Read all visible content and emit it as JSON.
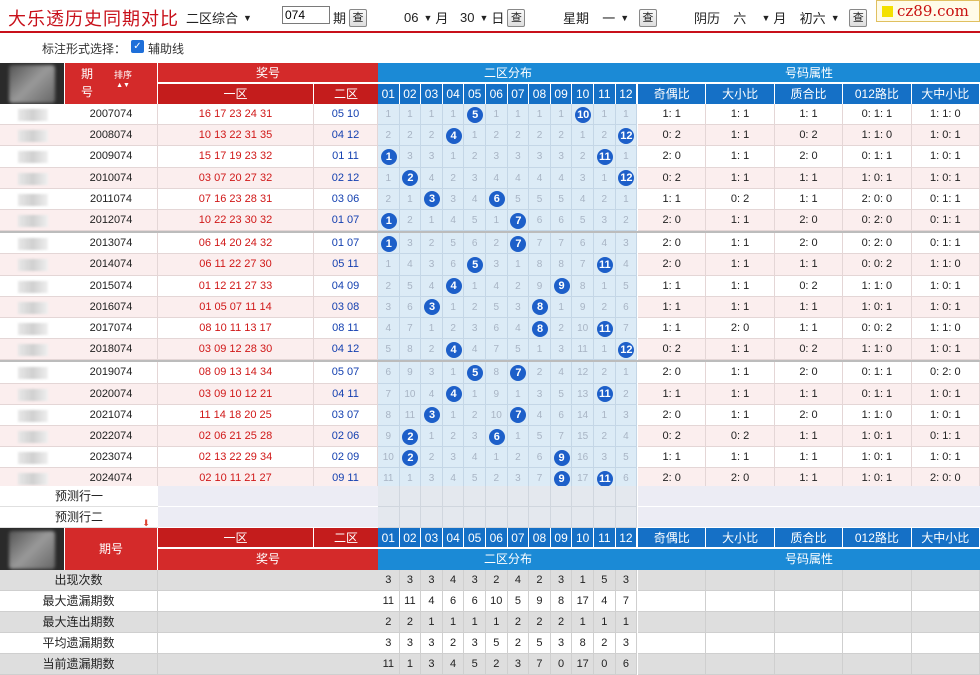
{
  "header": {
    "title": "大乐透历史同期对比",
    "zone_select": "二区综合",
    "period_value": "074",
    "period_label": "期",
    "month_value": "06",
    "month_label": "月",
    "day_value": "30",
    "day_label": "日",
    "weekday_label": "星期",
    "weekday_value": "一",
    "lunar_label": "阴历",
    "lunar_month": "六",
    "lunar_month_label": "月",
    "lunar_day": "初六",
    "query_label": "查",
    "logo": "cz89.com"
  },
  "markbar": {
    "label": "标注形式选择：",
    "checkbox_label": "辅助线",
    "checkbox_mark": "✓"
  },
  "columns": {
    "period": "期号",
    "period_top": "期",
    "period_bottom": "号",
    "sort": "排序",
    "prize": "奖号",
    "zone1": "一区",
    "zone2": "二区",
    "dist": "二区分布",
    "attr": "号码属性",
    "numbers": [
      "01",
      "02",
      "03",
      "04",
      "05",
      "06",
      "07",
      "08",
      "09",
      "10",
      "11",
      "12"
    ],
    "attrs": [
      "奇偶比",
      "大小比",
      "质合比",
      "012路比",
      "大中小比"
    ]
  },
  "rows": [
    {
      "period": "2007074",
      "front": "16 17 23 24 31",
      "back": "05 10",
      "dist": [
        1,
        1,
        1,
        1,
        "05",
        1,
        1,
        1,
        1,
        "10",
        1,
        1
      ],
      "attrs": [
        "1: 1",
        "1: 1",
        "1: 1",
        "0: 1: 1",
        "1: 1: 0"
      ]
    },
    {
      "period": "2008074",
      "front": "10 13 22 31 35",
      "back": "04 12",
      "dist": [
        2,
        2,
        2,
        "04",
        1,
        2,
        2,
        2,
        2,
        1,
        2,
        "12"
      ],
      "attrs": [
        "0: 2",
        "1: 1",
        "0: 2",
        "1: 1: 0",
        "1: 0: 1"
      ]
    },
    {
      "period": "2009074",
      "front": "15 17 19 23 32",
      "back": "01 11",
      "dist": [
        "01",
        3,
        3,
        1,
        2,
        3,
        3,
        3,
        3,
        2,
        "11",
        1
      ],
      "attrs": [
        "2: 0",
        "1: 1",
        "2: 0",
        "0: 1: 1",
        "1: 0: 1"
      ]
    },
    {
      "period": "2010074",
      "front": "03 07 20 27 32",
      "back": "02 12",
      "dist": [
        1,
        "02",
        4,
        2,
        3,
        4,
        4,
        4,
        4,
        3,
        1,
        "12"
      ],
      "attrs": [
        "0: 2",
        "1: 1",
        "1: 1",
        "1: 0: 1",
        "1: 0: 1"
      ]
    },
    {
      "period": "2011074",
      "front": "07 16 23 28 31",
      "back": "03 06",
      "dist": [
        2,
        1,
        "03",
        3,
        4,
        "06",
        5,
        5,
        5,
        4,
        2,
        1
      ],
      "attrs": [
        "1: 1",
        "0: 2",
        "1: 1",
        "2: 0: 0",
        "0: 1: 1"
      ]
    },
    {
      "period": "2012074",
      "front": "10 22 23 30 32",
      "back": "01 07",
      "dist": [
        "01",
        2,
        1,
        4,
        5,
        1,
        "07",
        6,
        6,
        5,
        3,
        2
      ],
      "attrs": [
        "2: 0",
        "1: 1",
        "2: 0",
        "0: 2: 0",
        "0: 1: 1"
      ]
    },
    {
      "period": "2013074",
      "front": "06 14 20 24 32",
      "back": "01 07",
      "dist": [
        "01",
        3,
        2,
        5,
        6,
        2,
        "07",
        7,
        7,
        6,
        4,
        3
      ],
      "attrs": [
        "2: 0",
        "1: 1",
        "2: 0",
        "0: 2: 0",
        "0: 1: 1"
      ]
    },
    {
      "period": "2014074",
      "front": "06 11 22 27 30",
      "back": "05 11",
      "dist": [
        1,
        4,
        3,
        6,
        "05",
        3,
        1,
        8,
        8,
        7,
        "11",
        4
      ],
      "attrs": [
        "2: 0",
        "1: 1",
        "1: 1",
        "0: 0: 2",
        "1: 1: 0"
      ]
    },
    {
      "period": "2015074",
      "front": "01 12 21 27 33",
      "back": "04 09",
      "dist": [
        2,
        5,
        4,
        "04",
        1,
        4,
        2,
        9,
        "09",
        8,
        1,
        5
      ],
      "attrs": [
        "1: 1",
        "1: 1",
        "0: 2",
        "1: 1: 0",
        "1: 0: 1"
      ]
    },
    {
      "period": "2016074",
      "front": "01 05 07 11 14",
      "back": "03 08",
      "dist": [
        3,
        6,
        "03",
        1,
        2,
        5,
        3,
        "08",
        1,
        9,
        2,
        6
      ],
      "attrs": [
        "1: 1",
        "1: 1",
        "1: 1",
        "1: 0: 1",
        "1: 0: 1"
      ]
    },
    {
      "period": "2017074",
      "front": "08 10 11 13 17",
      "back": "08 11",
      "dist": [
        4,
        7,
        1,
        2,
        3,
        6,
        4,
        "08",
        2,
        10,
        "11",
        7
      ],
      "attrs": [
        "1: 1",
        "2: 0",
        "1: 1",
        "0: 0: 2",
        "1: 1: 0"
      ]
    },
    {
      "period": "2018074",
      "front": "03 09 12 28 30",
      "back": "04 12",
      "dist": [
        5,
        8,
        2,
        "04",
        4,
        7,
        5,
        1,
        3,
        11,
        1,
        "12"
      ],
      "attrs": [
        "0: 2",
        "1: 1",
        "0: 2",
        "1: 1: 0",
        "1: 0: 1"
      ]
    },
    {
      "period": "2019074",
      "front": "08 09 13 14 34",
      "back": "05 07",
      "dist": [
        6,
        9,
        3,
        1,
        "05",
        8,
        "07",
        2,
        4,
        12,
        2,
        1
      ],
      "attrs": [
        "2: 0",
        "1: 1",
        "2: 0",
        "0: 1: 1",
        "0: 2: 0"
      ]
    },
    {
      "period": "2020074",
      "front": "03 09 10 12 21",
      "back": "04 11",
      "dist": [
        7,
        10,
        4,
        "04",
        1,
        9,
        1,
        3,
        5,
        13,
        "11",
        2
      ],
      "attrs": [
        "1: 1",
        "1: 1",
        "1: 1",
        "0: 1: 1",
        "1: 0: 1"
      ]
    },
    {
      "period": "2021074",
      "front": "11 14 18 20 25",
      "back": "03 07",
      "dist": [
        8,
        11,
        "03",
        1,
        2,
        10,
        "07",
        4,
        6,
        14,
        1,
        3
      ],
      "attrs": [
        "2: 0",
        "1: 1",
        "2: 0",
        "1: 1: 0",
        "1: 0: 1"
      ]
    },
    {
      "period": "2022074",
      "front": "02 06 21 25 28",
      "back": "02 06",
      "dist": [
        9,
        "02",
        1,
        2,
        3,
        "06",
        1,
        5,
        7,
        15,
        2,
        4
      ],
      "attrs": [
        "0: 2",
        "0: 2",
        "1: 1",
        "1: 0: 1",
        "0: 1: 1"
      ]
    },
    {
      "period": "2023074",
      "front": "02 13 22 29 34",
      "back": "02 09",
      "dist": [
        10,
        "02",
        2,
        3,
        4,
        1,
        2,
        6,
        "09",
        16,
        3,
        5
      ],
      "attrs": [
        "1: 1",
        "1: 1",
        "1: 1",
        "1: 0: 1",
        "1: 0: 1"
      ]
    },
    {
      "period": "2024074",
      "front": "02 10 11 21 27",
      "back": "09 11",
      "dist": [
        11,
        1,
        3,
        4,
        5,
        2,
        3,
        7,
        "09",
        17,
        "11",
        6
      ],
      "attrs": [
        "2: 0",
        "2: 0",
        "1: 1",
        "1: 0: 1",
        "2: 0: 0"
      ]
    }
  ],
  "predict": [
    "预测行一",
    "预测行二"
  ],
  "stats": [
    {
      "label": "出现次数",
      "values": [
        3,
        3,
        3,
        4,
        3,
        2,
        4,
        2,
        3,
        1,
        5,
        3
      ]
    },
    {
      "label": "最大遗漏期数",
      "values": [
        11,
        11,
        4,
        6,
        6,
        10,
        5,
        9,
        8,
        17,
        4,
        7
      ]
    },
    {
      "label": "最大连出期数",
      "values": [
        2,
        2,
        1,
        1,
        1,
        1,
        2,
        2,
        2,
        1,
        1,
        1
      ]
    },
    {
      "label": "平均遗漏期数",
      "values": [
        3,
        3,
        3,
        2,
        3,
        5,
        2,
        5,
        3,
        8,
        2,
        3
      ]
    },
    {
      "label": "当前遗漏期数",
      "values": [
        11,
        1,
        3,
        4,
        5,
        2,
        3,
        7,
        0,
        17,
        0,
        6
      ]
    }
  ],
  "colors": {
    "red": "#d42a2a",
    "blue": "#1b8ad6",
    "ball": "#1d5fc9",
    "front_text": "#d01818",
    "back_text": "#1440b0"
  }
}
